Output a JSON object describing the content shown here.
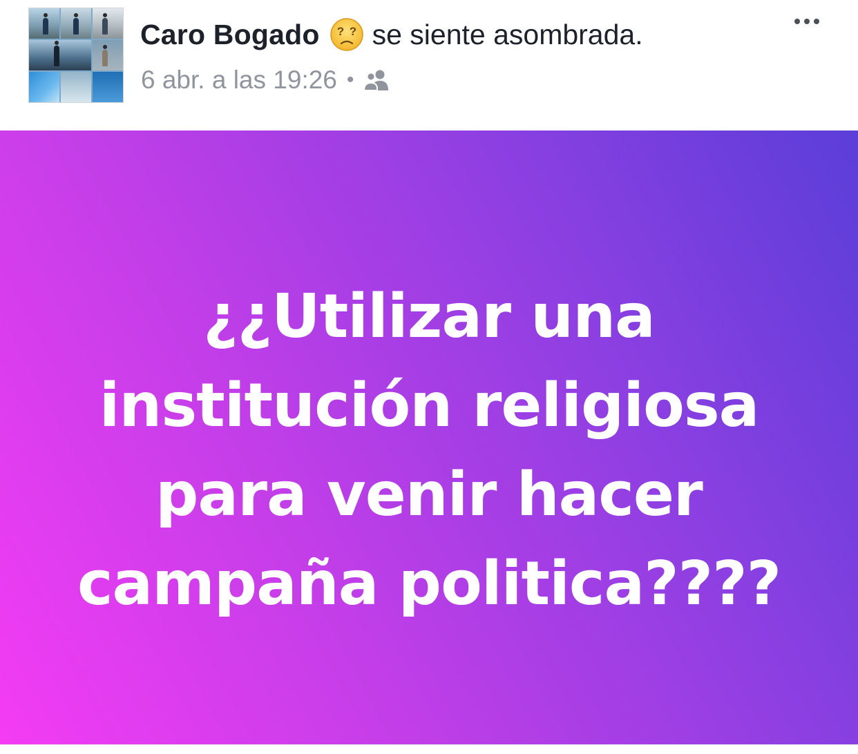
{
  "post": {
    "author": {
      "name": "Caro Bogado"
    },
    "feeling": {
      "icon": "astonished-face-emoji",
      "text": "se siente asombrada."
    },
    "timestamp": "6 abr. a las 19:26",
    "separator": "•",
    "audience_icon": "friends-icon",
    "more_icon": "more-options-icon",
    "content": {
      "lines": [
        "¿¿Utilizar una",
        "institución religiosa",
        "para venir hacer",
        "campaña politica????"
      ],
      "text_color": "#ffffff",
      "background_gradient": [
        "#f43cf4",
        "#c23ee8",
        "#8e3fe2",
        "#5b3ed8"
      ]
    }
  },
  "colors": {
    "name_text": "#1d2129",
    "meta_text": "#90949c"
  }
}
